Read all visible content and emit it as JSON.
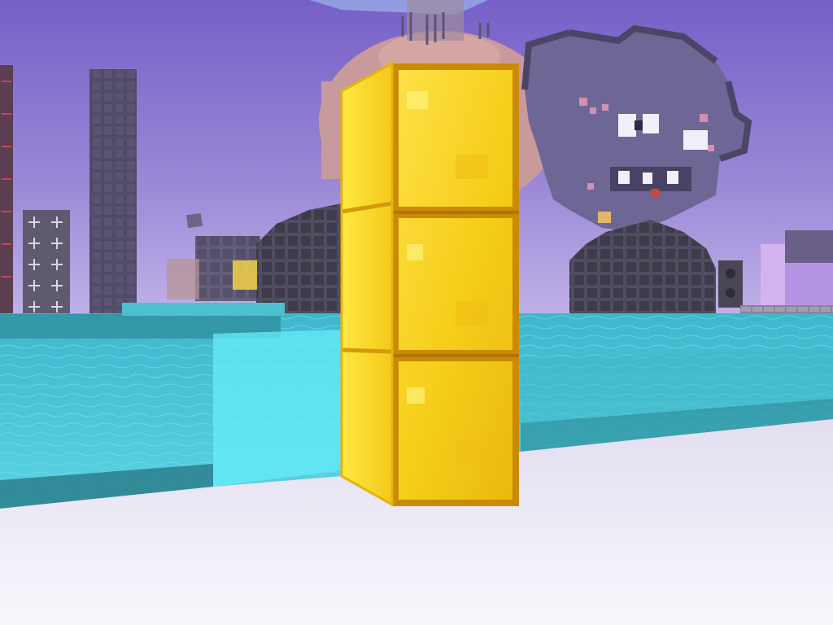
{
  "scene": {
    "type": "first-person voxel game view",
    "hud": "none visible",
    "colors": {
      "sky_top": "#7a63c9",
      "sky_horizon": "#b9a8e3",
      "water": "#49c6d8",
      "water_glass": "#5fe6f5",
      "floor": "#ece9f5",
      "gold": "#f2c21a",
      "gold_edge": "#c98a06",
      "dark_block": "#3d3a48",
      "pixel_art_body": "#6c6593",
      "tower": "#55506e"
    },
    "objects": [
      {
        "name": "gold-block-pillar",
        "blocks": 3,
        "material": "gold block"
      },
      {
        "name": "pixel-art-creature",
        "material": "purple wool pixel art"
      },
      {
        "name": "dark-stone-dome-left",
        "material": "dark stone"
      },
      {
        "name": "dark-stone-dome-right",
        "material": "dark stone"
      },
      {
        "name": "tall-stone-tower",
        "material": "stone"
      },
      {
        "name": "cross-pattern-building",
        "material": "stone"
      },
      {
        "name": "pink-sphere-statue",
        "material": "terracotta"
      },
      {
        "name": "water-plane",
        "material": "water"
      },
      {
        "name": "white-floor",
        "material": "snow / quartz"
      }
    ]
  }
}
